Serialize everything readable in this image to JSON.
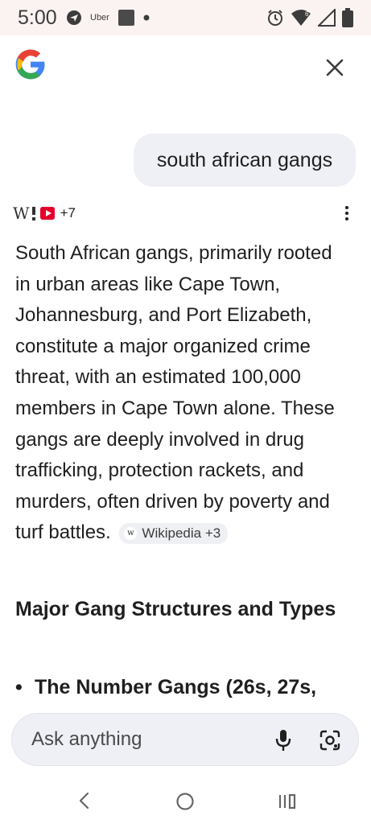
{
  "status_bar": {
    "time": "5:00",
    "uber_label": "Uber"
  },
  "query": {
    "text": "south african gangs"
  },
  "sources": {
    "wiki_glyph": "W",
    "count_label": "+7"
  },
  "answer": {
    "paragraph": "South African gangs, primarily rooted in urban areas like Cape Town, Johannesburg, and Port Elizabeth, constitute a major organized crime threat, with an estimated 100,000 members in Cape Town alone. These gangs are deeply involved in drug trafficking, protection rackets, and murders, often driven by poverty and turf battles.",
    "citation_label": "Wikipedia +3",
    "citation_glyph": "w"
  },
  "section": {
    "heading": "Major Gang Structures and Types",
    "bullet_1": "The Number Gangs (26s, 27s,"
  },
  "input": {
    "placeholder": "Ask anything"
  },
  "icons": {
    "logo": "google-g-logo",
    "close": "close-icon",
    "more": "more-vert-icon",
    "mic": "mic-icon",
    "lens": "lens-camera-icon",
    "back": "nav-back-icon",
    "home": "nav-home-icon",
    "recent": "nav-recent-icon"
  },
  "colors": {
    "status_bar_bg": "#fbf3f2",
    "bubble_bg": "#eef0f5",
    "text": "#1f1f1f",
    "google_blue": "#4285F4",
    "google_red": "#EA4335",
    "google_yellow": "#FBBC05",
    "google_green": "#34A853"
  }
}
